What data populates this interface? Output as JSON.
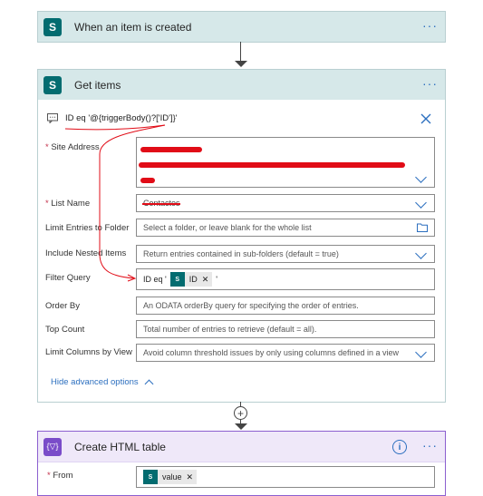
{
  "trigger": {
    "title": "When an item is created",
    "more": "···"
  },
  "get_items": {
    "title": "Get items",
    "more": "···",
    "comment": "ID eq '@{triggerBody()?['ID']}'",
    "fields": {
      "site_address": {
        "label": "Site Address",
        "required": true
      },
      "list_name": {
        "label": "List Name",
        "required": true,
        "value": "Contactos"
      },
      "limit_folder": {
        "label": "Limit Entries to Folder",
        "placeholder": "Select a folder, or leave blank for the whole list"
      },
      "nested": {
        "label": "Include Nested Items",
        "placeholder": "Return entries contained in sub-folders (default = true)"
      },
      "filter": {
        "label": "Filter Query",
        "prefix": "ID eq '",
        "token": "ID",
        "suffix": "'"
      },
      "order_by": {
        "label": "Order By",
        "placeholder": "An ODATA orderBy query for specifying the order of entries."
      },
      "top_count": {
        "label": "Top Count",
        "placeholder": "Total number of entries to retrieve (default = all)."
      },
      "limit_columns": {
        "label": "Limit Columns by View",
        "placeholder": "Avoid column threshold issues by only using columns defined in a view"
      }
    },
    "hide_advanced": "Hide advanced options"
  },
  "html_table": {
    "title": "Create HTML table",
    "more": "···",
    "icon_text": "{▽}",
    "from": {
      "label": "From",
      "required": true,
      "token": "value"
    }
  },
  "icons": [
    "sharepoint-icon",
    "more-icon",
    "comment-icon",
    "close-icon",
    "chevron-down-icon",
    "folder-icon",
    "chevron-up-icon",
    "add-icon",
    "info-icon",
    "data-operation-icon"
  ],
  "colors": {
    "accent": "#2c6fbf",
    "sharepoint": "#036c70",
    "annotation": "#e10c17",
    "html_table": "#7a4cc9"
  }
}
